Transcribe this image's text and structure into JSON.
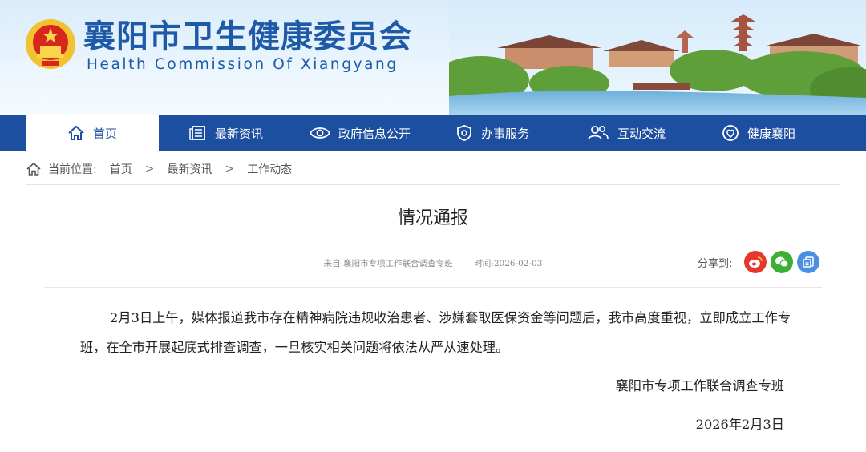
{
  "header": {
    "title_cn": "襄阳市卫生健康委员会",
    "title_en": "Health Commission Of Xiangyang",
    "emblem_icon": "national-emblem-icon"
  },
  "nav": {
    "items": [
      {
        "label": "首页",
        "icon": "home-icon",
        "active": true
      },
      {
        "label": "最新资讯",
        "icon": "news-icon",
        "active": false
      },
      {
        "label": "政府信息公开",
        "icon": "eye-icon",
        "active": false
      },
      {
        "label": "办事服务",
        "icon": "shield-service-icon",
        "active": false
      },
      {
        "label": "互动交流",
        "icon": "people-icon",
        "active": false
      },
      {
        "label": "健康襄阳",
        "icon": "health-icon",
        "active": false
      }
    ]
  },
  "breadcrumb": {
    "label": "当前位置:",
    "items": [
      "首页",
      "最新资讯",
      "工作动态"
    ],
    "separator": ">"
  },
  "article": {
    "title": "情况通报",
    "source_label": "来自:",
    "source": "襄阳市专项工作联合调查专班",
    "time_label": "时间:",
    "time": "2026-02-03",
    "body": "2月3日上午，媒体报道我市存在精神病院违规收治患者、涉嫌套取医保资金等问题后，我市高度重视，立即成立工作专班，在全市开展起底式排查调查，一旦核实相关问题将依法从严从速处理。",
    "signature": "襄阳市专项工作联合调查专班",
    "date": "2026年2月3日"
  },
  "share": {
    "label": "分享到:",
    "buttons": [
      {
        "icon": "weibo-icon",
        "color": "#e6372e"
      },
      {
        "icon": "wechat-icon",
        "color": "#3cb034"
      },
      {
        "icon": "copy-icon",
        "color": "#4a90e2"
      }
    ]
  },
  "colors": {
    "nav_bg": "#1d4fa0",
    "title_blue": "#1e5aa8"
  }
}
